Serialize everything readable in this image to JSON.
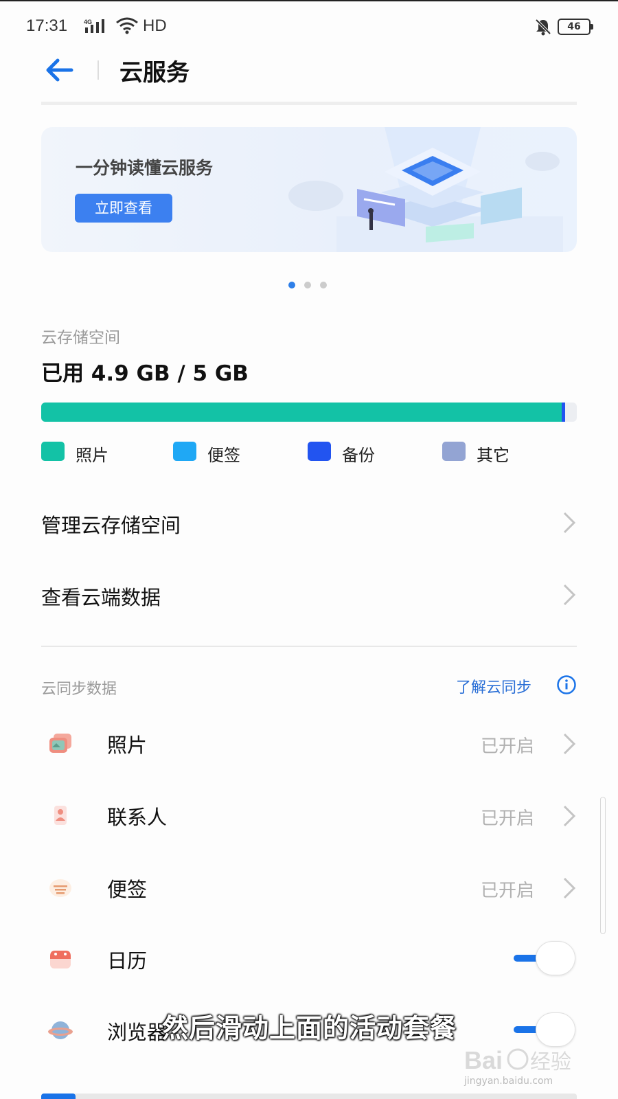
{
  "status_bar": {
    "time": "17:31",
    "network": "4G",
    "hd": "HD",
    "battery": "46"
  },
  "header": {
    "title": "云服务"
  },
  "banner": {
    "text": "一分钟读懂云服务",
    "button_label": "立即查看",
    "pages": 3,
    "active_page": 1
  },
  "storage": {
    "label": "云存储空间",
    "used_text": "已用 4.9 GB / 5 GB",
    "used_gb": 4.9,
    "total_gb": 5,
    "legend": [
      {
        "label": "照片",
        "color": "#13c2a6"
      },
      {
        "label": "便签",
        "color": "#1fa8f5"
      },
      {
        "label": "备份",
        "color": "#2254f0"
      },
      {
        "label": "其它",
        "color": "#93a4d3"
      }
    ]
  },
  "menu": {
    "manage": "管理云存储空间",
    "view_cloud": "查看云端数据"
  },
  "sync": {
    "header": "云同步数据",
    "learn_link": "了解云同步",
    "items": [
      {
        "label": "照片",
        "status": "已开启",
        "icon": "photos-icon"
      },
      {
        "label": "联系人",
        "status": "已开启",
        "icon": "contacts-icon"
      },
      {
        "label": "便签",
        "status": "已开启",
        "icon": "notes-icon"
      },
      {
        "label": "日历",
        "toggle_on": true,
        "icon": "calendar-icon"
      },
      {
        "label": "浏览器",
        "toggle_on": true,
        "icon": "browser-icon"
      }
    ]
  },
  "overlay": {
    "subtitle": "然后滑动上面的活动套餐",
    "watermark": "jingyan.baidu.com"
  },
  "colors": {
    "accent": "#1a73e8",
    "photos_bar": "#13c2a6",
    "backup_bar": "#2254f0"
  }
}
